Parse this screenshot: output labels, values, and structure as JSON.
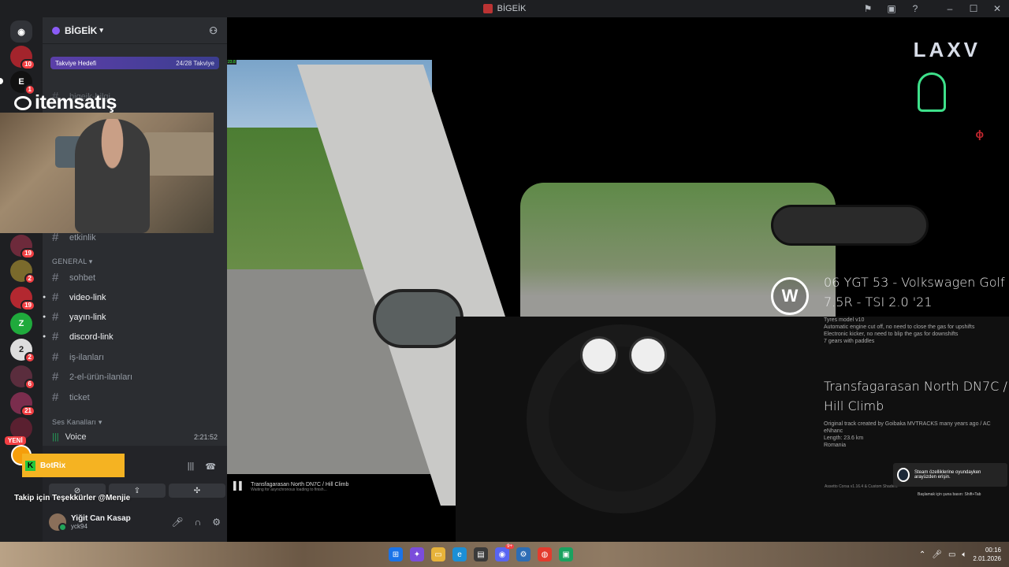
{
  "window": {
    "title": "BİGEİK",
    "controls": [
      "flag-icon",
      "inbox-icon",
      "help-icon",
      "minimize-icon",
      "maximize-icon",
      "close-icon"
    ]
  },
  "server_rail": {
    "badges": [
      "10",
      "1",
      "19",
      "2",
      "19",
      "2",
      "6",
      "21"
    ],
    "new_label": "YENİ"
  },
  "server": {
    "name": "BİGEİK",
    "boost": {
      "label": "Takviye Hedefi",
      "progress": "24/28 Takviye"
    },
    "channels_top": [
      {
        "name": "bigeik-bilgi"
      },
      {
        "name": "etkinlik"
      }
    ],
    "category_general": "GENERAL",
    "channels": [
      {
        "name": "sohbet",
        "bold": false
      },
      {
        "name": "video-link",
        "bold": true
      },
      {
        "name": "yayın-link",
        "bold": true
      },
      {
        "name": "discord-link",
        "bold": true
      },
      {
        "name": "iş-ilanları",
        "bold": false
      },
      {
        "name": "2-el-ürün-ilanları",
        "bold": false
      },
      {
        "name": "ticket",
        "bold": false
      }
    ],
    "category_voice": "Ses Kanalları",
    "voice": {
      "name": "Voice",
      "time": "2:21:52"
    }
  },
  "user": {
    "display_name": "Yiğit Can Kasap",
    "username": "yck94"
  },
  "overlays": {
    "itemsatis": "itemsatış",
    "botrix": "BotRix",
    "thanks": "Takip için Teşekkürler @Menjie"
  },
  "game": {
    "sponsor": "LAXV",
    "car_title": "06 YGT 53 - Volkswagen Golf 7.5R - TSI 2.0 '21",
    "car_notes": [
      "Tyres model v10",
      "Automatic engine cut off, no need to close the gas for upshifts",
      "Electronic kicker, no need to blip the gas for downshifts",
      "7 gears with paddles"
    ],
    "track_title": "Transfagarasan North DN7C / Hill Climb",
    "track_notes": [
      "Original track created by Goibaka MVTRACKS many years ago / AC eNhanc",
      "Length: 23.6 km",
      "Romania"
    ],
    "loading_title": "Transfagarasan North DN7C / Hill Climb",
    "loading_sub": "Waiting for asynchronous loading to finish...",
    "version": "Assetto Corsa v1.16.4 & Custom Shaders",
    "steam_msg": "Steam özelliklerine oyundayken arayüzden erişin.",
    "steam_hint": "Başlamak için şuna basın: Shift+Tab"
  },
  "taskbar": {
    "time": "00:16",
    "date": "2.01.2026",
    "chat_badge": "9+"
  },
  "colors": {
    "discord_bg": "#2b2d31",
    "rail_bg": "#1e1f22",
    "boost": "#5b3fa8",
    "online": "#23a55a",
    "botrix": "#f5b322"
  }
}
